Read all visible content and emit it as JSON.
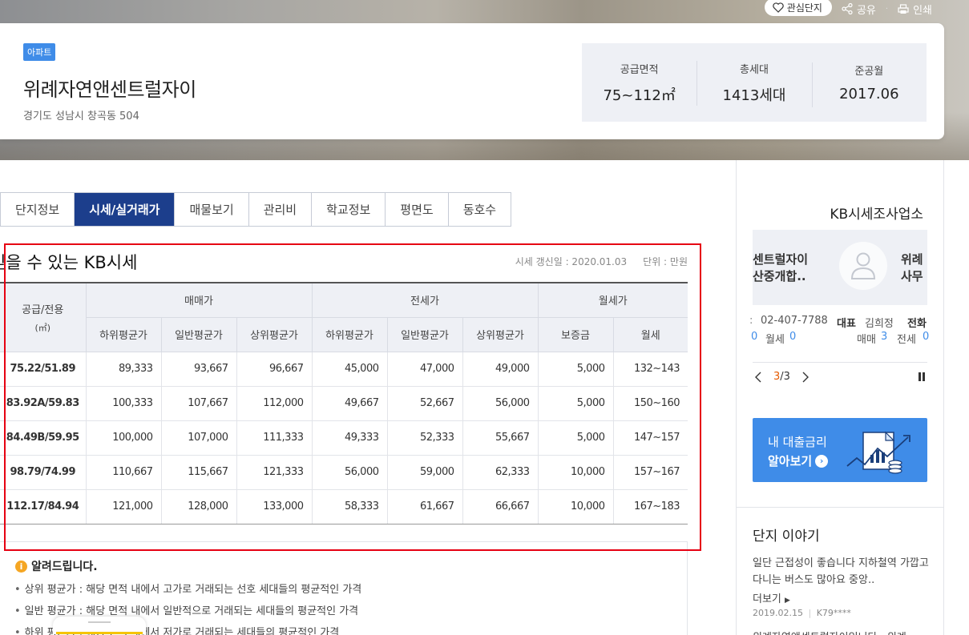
{
  "top_actions": {
    "favorite": "관심단지",
    "share": "공유",
    "print": "인쇄"
  },
  "complex": {
    "type_badge": "아파트",
    "name": "위례자연앤센트럴자이",
    "address": "경기도 성남시 창곡동 504",
    "stats": [
      {
        "label": "공급면적",
        "value": "75~112㎡"
      },
      {
        "label": "총세대",
        "value": "1413세대"
      },
      {
        "label": "준공월",
        "value": "2017.06"
      }
    ]
  },
  "tabs": [
    "단지정보",
    "시세/실거래가",
    "매물보기",
    "관리비",
    "학교정보",
    "평면도",
    "동호수"
  ],
  "active_tab_index": 1,
  "price_section": {
    "title": "믿을 수 있는 KB시세",
    "updated": "시세 갱신일 : 2020.01.03",
    "unit": "단위 : 만원",
    "header": {
      "area": "공급/전용",
      "area_unit": "(㎡)",
      "groups": [
        "매매가",
        "전세가",
        "월세가"
      ],
      "sub": [
        "하위평균가",
        "일반평균가",
        "상위평균가",
        "하위평균가",
        "일반평균가",
        "상위평균가",
        "보증금",
        "월세"
      ]
    },
    "rows": [
      [
        "75.22/51.89",
        "89,333",
        "93,667",
        "96,667",
        "45,000",
        "47,000",
        "49,000",
        "5,000",
        "132~143"
      ],
      [
        "83.92A/59.83",
        "100,333",
        "107,667",
        "112,000",
        "49,667",
        "52,667",
        "56,000",
        "5,000",
        "150~160"
      ],
      [
        "84.49B/59.95",
        "100,000",
        "107,000",
        "111,333",
        "49,333",
        "52,333",
        "55,667",
        "5,000",
        "147~157"
      ],
      [
        "98.79/74.99",
        "110,667",
        "115,667",
        "121,333",
        "56,000",
        "59,000",
        "62,333",
        "10,000",
        "157~167"
      ],
      [
        "112.17/84.94",
        "121,000",
        "128,000",
        "133,000",
        "58,333",
        "61,667",
        "66,667",
        "10,000",
        "167~183"
      ]
    ]
  },
  "notice": {
    "title": "알려드립니다.",
    "items": [
      "상위 평균가 : 해당 면적 내에서 고가로 거래되는 선호 세대들의 평균적인 가격",
      "일반 평균가 : 해당 면적 내에서 일반적으로 거래되는 세대들의 평균적인 가격",
      "하위 평균가 : 해당 면적 내에서 저가로 거래되는 세대들의 평균적인 가격"
    ]
  },
  "sidebar": {
    "agency_title": "KB시세조사업소",
    "agency_left": [
      "센트럴자이",
      "산중개합.."
    ],
    "agency_right": [
      "위례",
      "사무"
    ],
    "phone": "02-407-7788",
    "rep_label": "대표",
    "rep_name": "김희정",
    "tel_label": "전화",
    "monthly_label": "월세",
    "monthly_count": "0",
    "sale_label": "매매",
    "sale_count": "3",
    "jeonse_label": "전세",
    "jeonse_count": "0",
    "pager_current": "3",
    "pager_total": "/3",
    "loan_line1": "내 대출금리",
    "loan_line2": "알아보기",
    "story_title": "단지 이야기",
    "story_text": "일단 근접성이 좋습니다 지하철역 가깝고다니는 버스도 많아요 중앙..",
    "story_more": "더보기",
    "story_date": "2019.02.15",
    "story_author": "K79****",
    "story_next": "위례자연앤센트럴자이입니다 . 위례"
  },
  "colors": {
    "accent": "#3f8ce8",
    "tab_active": "#1c3e8c",
    "highlight": "#e60012"
  }
}
